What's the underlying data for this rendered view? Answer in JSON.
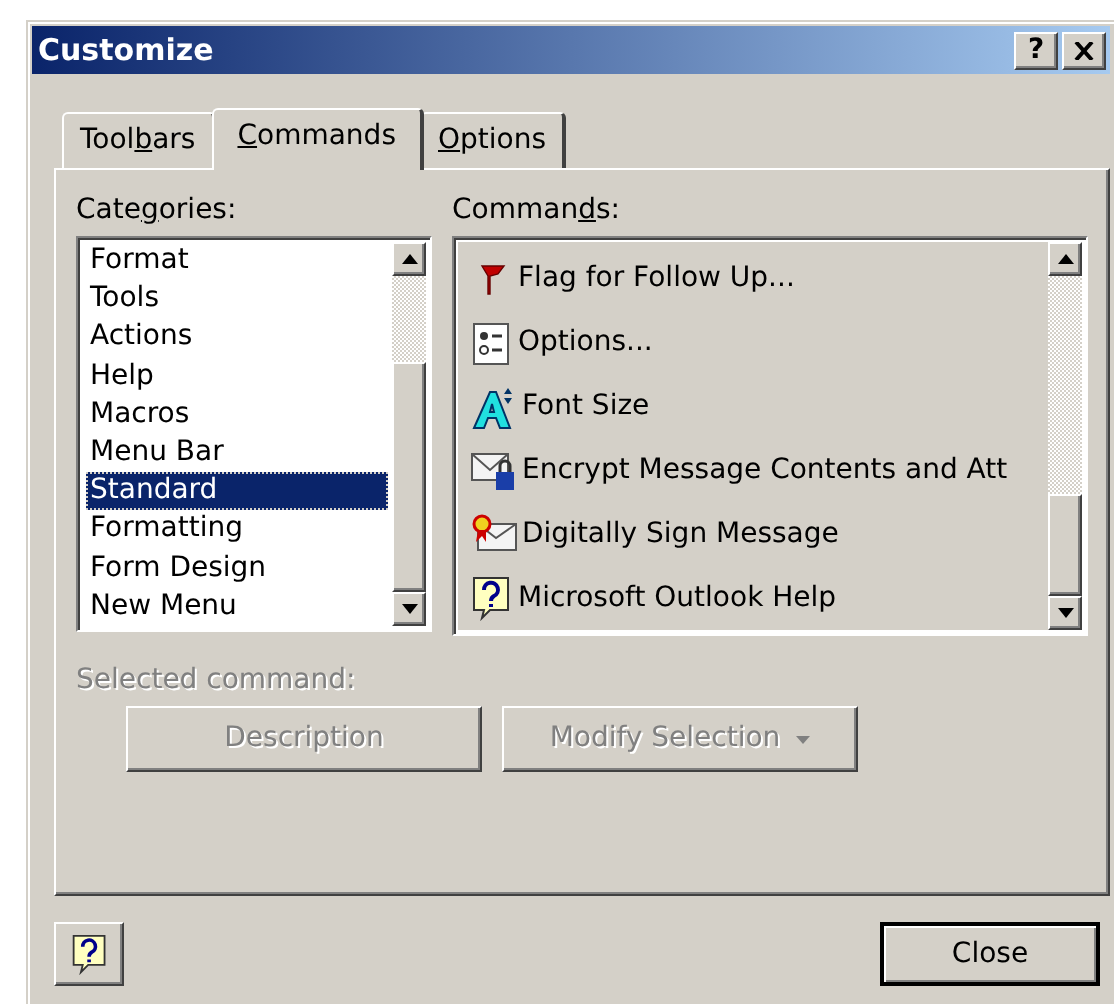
{
  "window": {
    "title": "Customize",
    "help_button": "?"
  },
  "tabs": [
    {
      "parts": {
        "before": "Tool",
        "key": "b",
        "after": "ars"
      },
      "selected": false
    },
    {
      "parts": {
        "key": "C",
        "after": "ommands"
      },
      "selected": true
    },
    {
      "parts": {
        "key": "O",
        "after": "ptions"
      },
      "selected": false
    }
  ],
  "categories": {
    "label_parts": {
      "before": "Cate",
      "key": "g",
      "after": "ories:"
    },
    "items": [
      {
        "label": "Format",
        "selected": false
      },
      {
        "label": "Tools",
        "selected": false
      },
      {
        "label": "Actions",
        "selected": false
      },
      {
        "label": "Help",
        "selected": false
      },
      {
        "label": "Macros",
        "selected": false
      },
      {
        "label": "Menu Bar",
        "selected": false
      },
      {
        "label": "Standard",
        "selected": true
      },
      {
        "label": "Formatting",
        "selected": false
      },
      {
        "label": "Form Design",
        "selected": false
      },
      {
        "label": "New Menu",
        "selected": false
      }
    ]
  },
  "commands": {
    "label_parts": {
      "before": "Comman",
      "key": "d",
      "after": "s:"
    },
    "items": [
      {
        "kind": "flag",
        "label": "Flag for Follow Up..."
      },
      {
        "kind": "options",
        "label": "Options..."
      },
      {
        "kind": "font-size",
        "label": "Font Size"
      },
      {
        "kind": "encrypt",
        "label": "Encrypt Message Contents and Att"
      },
      {
        "kind": "sign",
        "label": "Digitally Sign Message"
      },
      {
        "kind": "help",
        "label": "Microsoft Outlook Help"
      }
    ]
  },
  "selected_command": {
    "label": "Selected command:",
    "disabled": true,
    "buttons": [
      {
        "kind": "plain",
        "label": "Description"
      },
      {
        "kind": "dropdown",
        "label": "Modify Selection"
      }
    ]
  },
  "footer": {
    "close_button": "Close"
  }
}
